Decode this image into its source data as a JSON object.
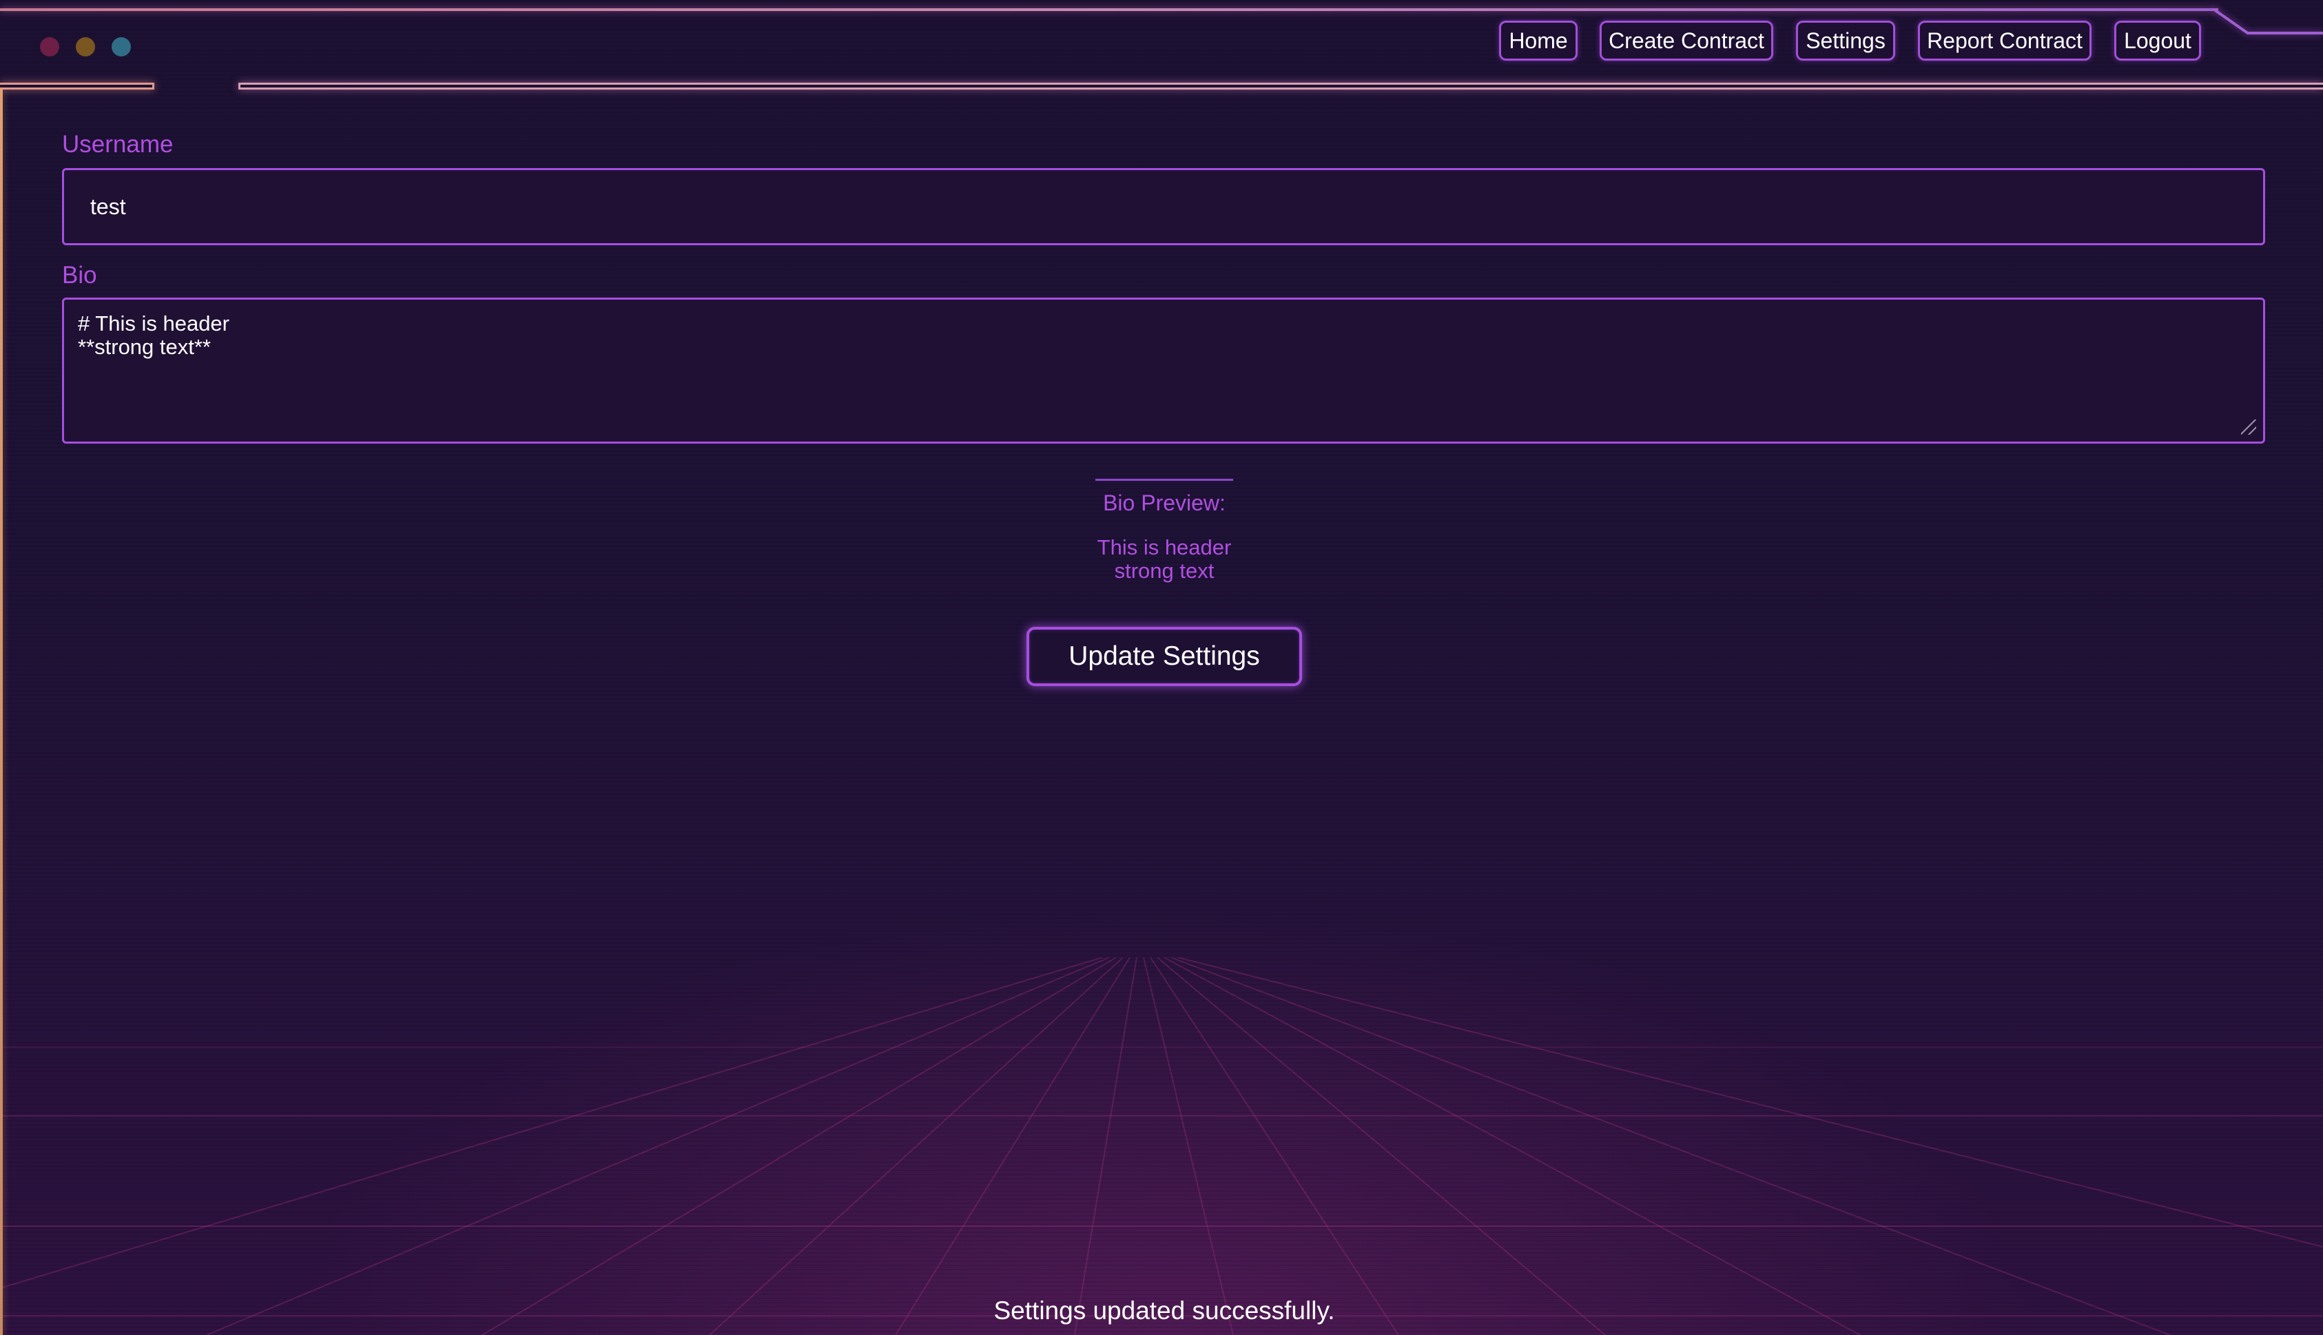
{
  "nav": {
    "items": [
      {
        "label": "Home"
      },
      {
        "label": "Create Contract"
      },
      {
        "label": "Settings"
      },
      {
        "label": "Report Contract"
      },
      {
        "label": "Logout"
      }
    ]
  },
  "form": {
    "username_label": "Username",
    "username_value": "test",
    "bio_label": "Bio",
    "bio_value": "# This is header\n**strong text**",
    "preview_title": "Bio Preview:",
    "preview_lines": [
      "This is header",
      "strong text"
    ],
    "submit_label": "Update Settings"
  },
  "status": {
    "message": "Settings updated successfully."
  },
  "colors": {
    "accent": "#a64ee0",
    "label": "#b04fe0",
    "background": "#1d1133",
    "frame": "#e09a8a"
  },
  "icons": {
    "window_controls": [
      "close-dot",
      "minimize-dot",
      "maximize-dot"
    ]
  }
}
